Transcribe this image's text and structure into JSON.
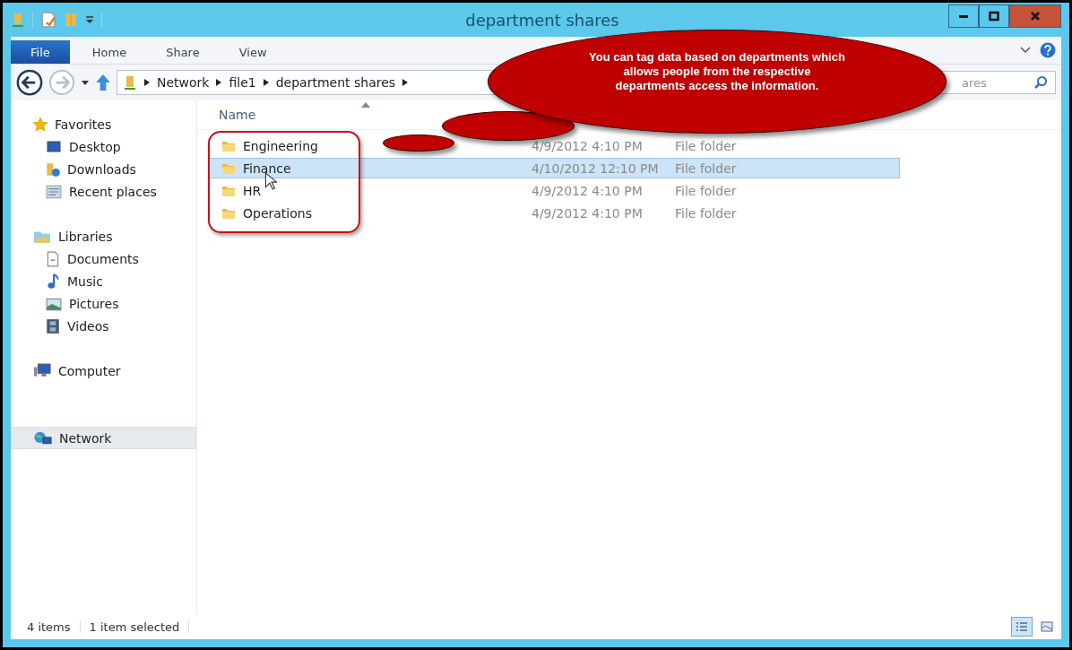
{
  "window": {
    "title": "department shares"
  },
  "ribbon_tabs": [
    {
      "label": "File",
      "kind": "file",
      "selected": false
    },
    {
      "label": "Home",
      "kind": "tab",
      "selected": false
    },
    {
      "label": "Share",
      "kind": "tab",
      "selected": false
    },
    {
      "label": "View",
      "kind": "tab",
      "selected": false
    }
  ],
  "address": {
    "path": [
      "Network",
      "file1",
      "department shares"
    ]
  },
  "search": {
    "placeholder": "ares"
  },
  "sidebar": {
    "groups": [
      {
        "label": "Favorites",
        "selected": false,
        "children": [
          {
            "label": "Desktop",
            "selected": false
          },
          {
            "label": "Downloads",
            "selected": false
          },
          {
            "label": "Recent places",
            "selected": false
          }
        ]
      },
      {
        "label": "Libraries",
        "selected": false,
        "children": [
          {
            "label": "Documents",
            "selected": false
          },
          {
            "label": "Music",
            "selected": false
          },
          {
            "label": "Pictures",
            "selected": false
          },
          {
            "label": "Videos",
            "selected": false
          }
        ]
      },
      {
        "label": "Computer",
        "selected": false
      },
      {
        "label": "Network",
        "selected": true
      }
    ]
  },
  "columns": [
    {
      "label": "Name"
    }
  ],
  "rows": [
    {
      "name": "Engineering",
      "date": "4/9/2012 4:10 PM",
      "type": "File folder",
      "selected": false
    },
    {
      "name": "Finance",
      "date": "4/10/2012 12:10 PM",
      "type": "File folder",
      "selected": true
    },
    {
      "name": "HR",
      "date": "4/9/2012 4:10 PM",
      "type": "File folder",
      "selected": false
    },
    {
      "name": "Operations",
      "date": "4/9/2012 4:10 PM",
      "type": "File folder",
      "selected": false
    }
  ],
  "status_bar": {
    "item_count": "4 items",
    "selection": "1 item selected"
  },
  "view_buttons": [
    {
      "kind": "details",
      "selected": true
    },
    {
      "kind": "large-icons",
      "selected": false
    }
  ],
  "callout": {
    "text": "You can tag data based on departments which\nallows people from the respective\ndepartments access the information."
  }
}
